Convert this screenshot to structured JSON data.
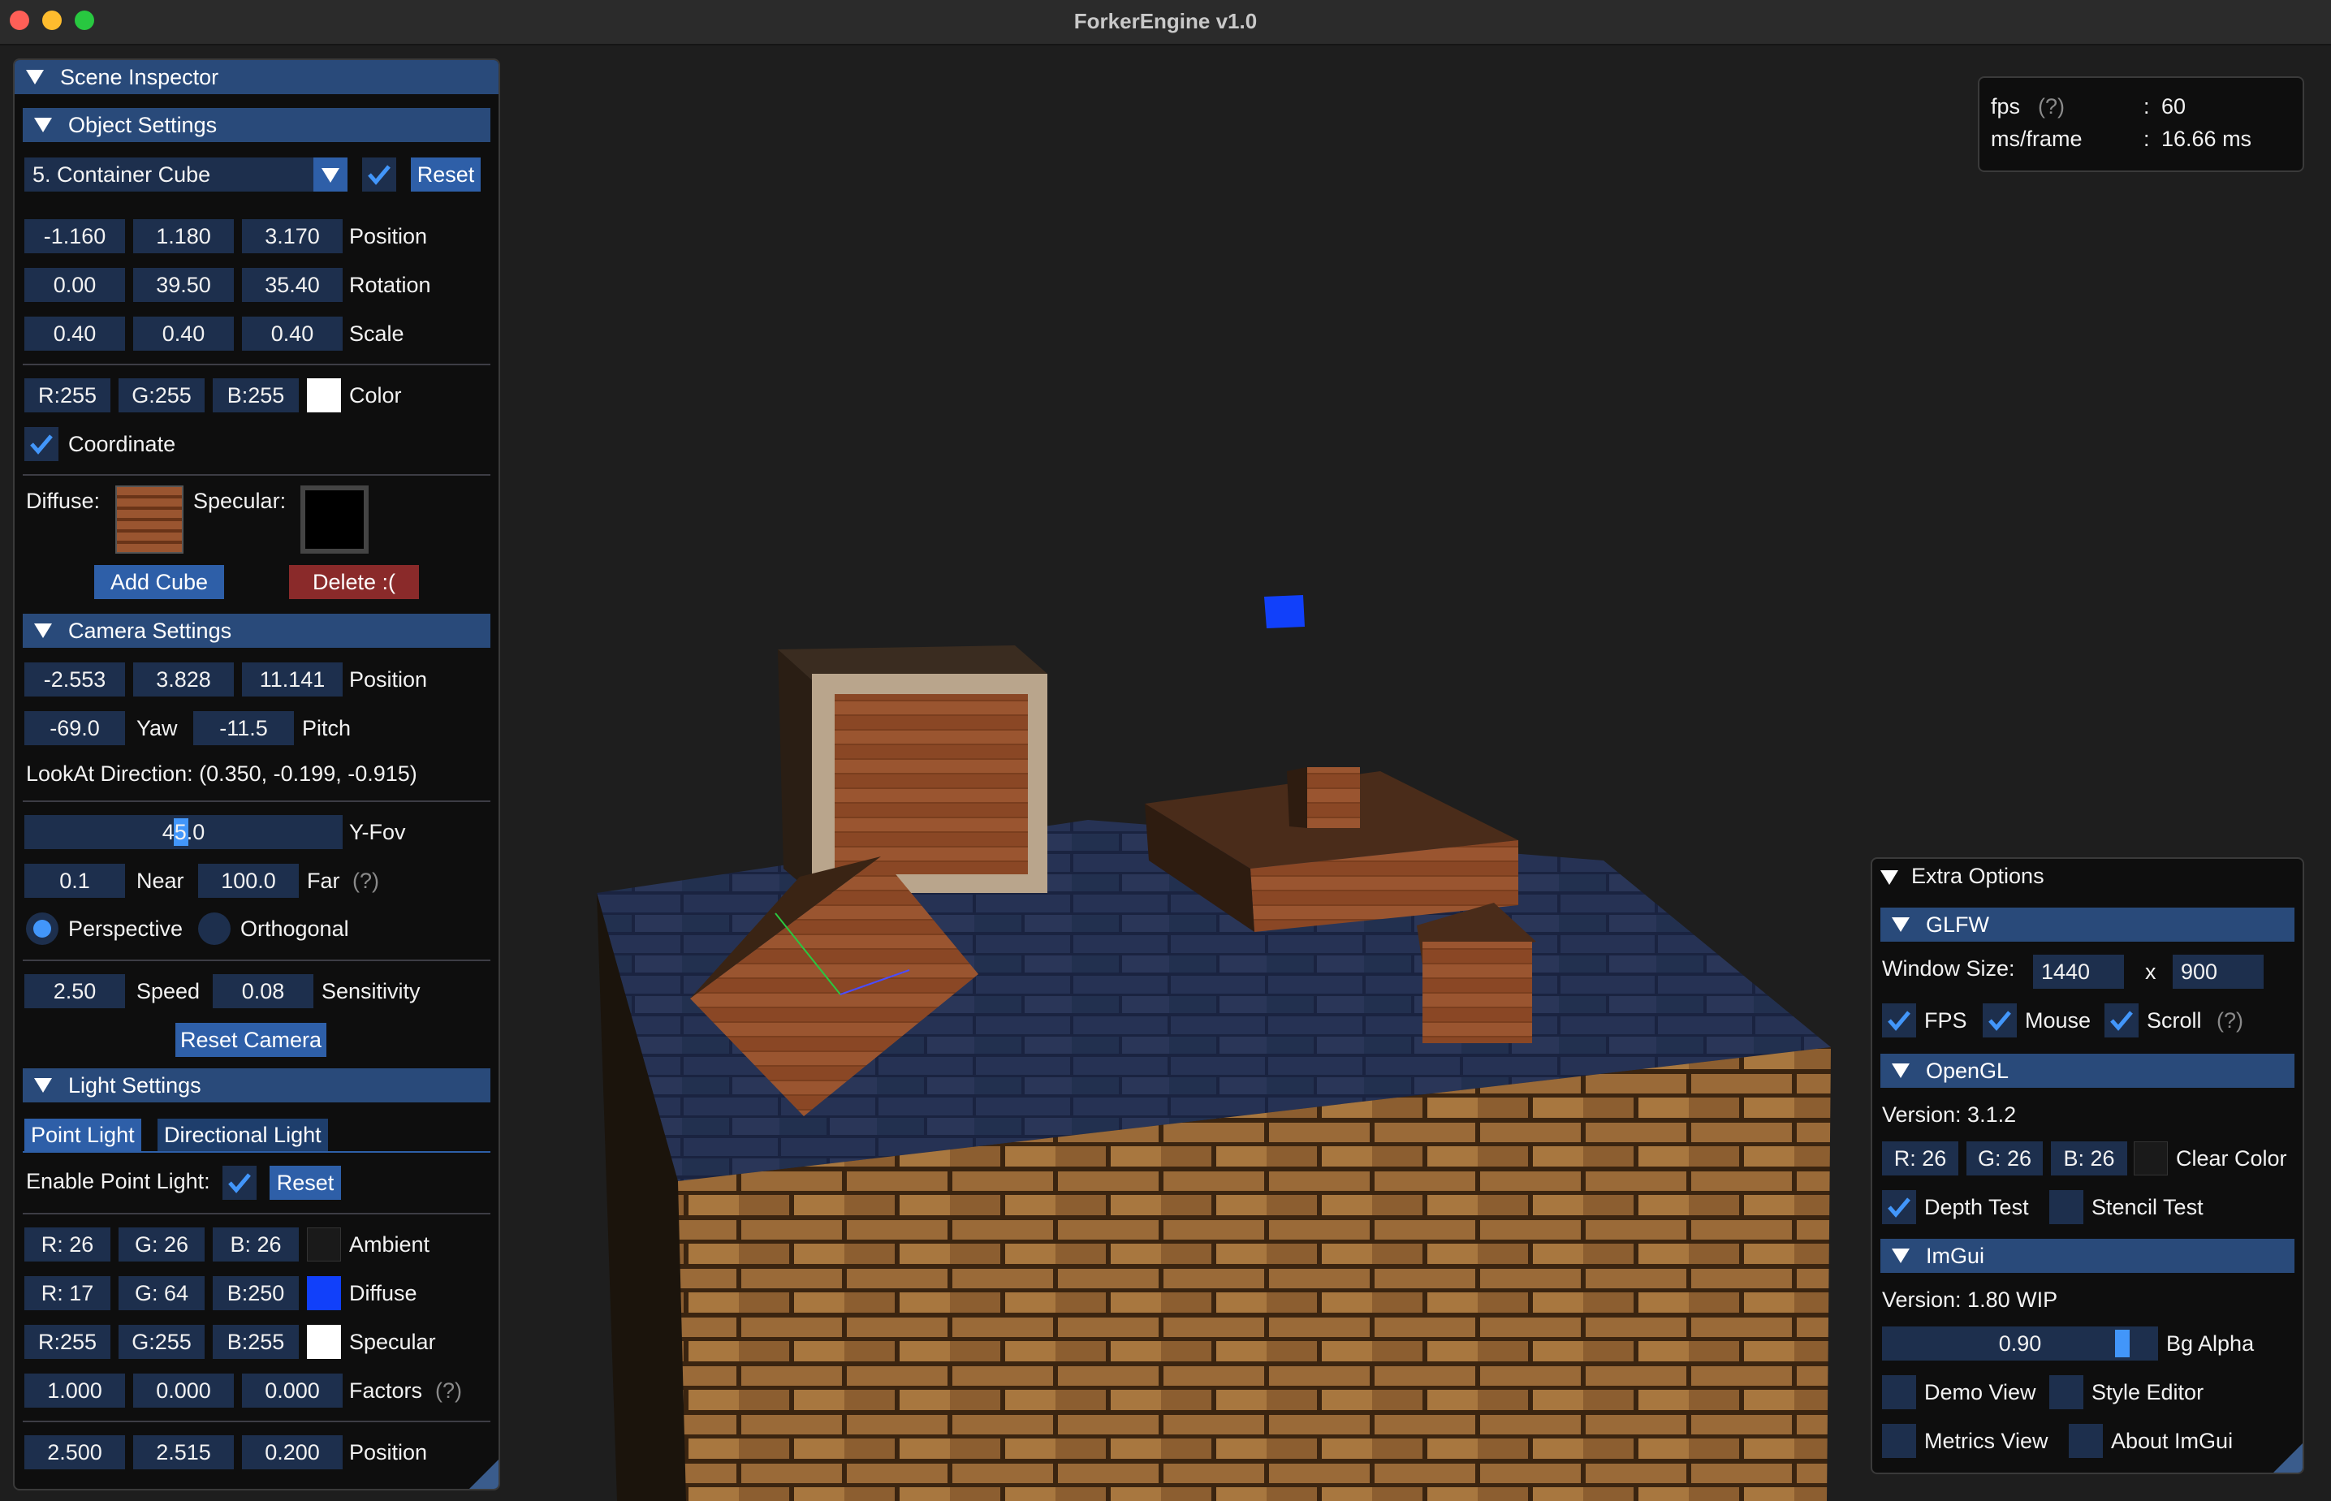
{
  "app": {
    "window_title": "ForkerEngine v1.0"
  },
  "colors": {
    "header": "#294a7a",
    "field": "#1d2f4d",
    "button": "#2e5fa8",
    "delete": "#8a2a2a",
    "check": "#4296fa"
  },
  "scene_inspector": {
    "title": "Scene Inspector",
    "object_settings": {
      "header": "Object Settings",
      "selected_object": "5. Container Cube",
      "reset_label": "Reset",
      "position": [
        "-1.160",
        "1.180",
        "3.170"
      ],
      "position_label": "Position",
      "rotation": [
        "0.00",
        "39.50",
        "35.40"
      ],
      "rotation_label": "Rotation",
      "scale": [
        "0.40",
        "0.40",
        "0.40"
      ],
      "scale_label": "Scale",
      "color": [
        "R:255",
        "G:255",
        "B:255"
      ],
      "color_label": "Color",
      "color_swatch": "#ffffff",
      "coordinate_label": "Coordinate",
      "diffuse_label": "Diffuse:",
      "specular_label": "Specular:",
      "add_cube_label": "Add Cube",
      "delete_label": "Delete :("
    },
    "camera_settings": {
      "header": "Camera Settings",
      "position": [
        "-2.553",
        "3.828",
        "11.141"
      ],
      "position_label": "Position",
      "yaw": "-69.0",
      "yaw_label": "Yaw",
      "pitch": "-11.5",
      "pitch_label": "Pitch",
      "lookat": "LookAt Direction: (0.350, -0.199, -0.915)",
      "fov": "45.0",
      "fov_label": "Y-Fov",
      "near": "0.1",
      "near_label": "Near",
      "far": "100.0",
      "far_label": "Far",
      "help": "(?)",
      "perspective_label": "Perspective",
      "orthogonal_label": "Orthogonal",
      "speed": "2.50",
      "speed_label": "Speed",
      "sensitivity": "0.08",
      "sensitivity_label": "Sensitivity",
      "reset_camera_label": "Reset Camera"
    },
    "light_settings": {
      "header": "Light Settings",
      "tabs": [
        "Point Light",
        "Directional Light"
      ],
      "enable_label": "Enable Point Light:",
      "reset_label": "Reset",
      "ambient": [
        "R: 26",
        "G: 26",
        "B: 26"
      ],
      "ambient_label": "Ambient",
      "ambient_swatch": "#1a1a1a",
      "diffuse": [
        "R: 17",
        "G: 64",
        "B:250"
      ],
      "diffuse_label": "Diffuse",
      "diffuse_swatch": "#1140fa",
      "specular": [
        "R:255",
        "G:255",
        "B:255"
      ],
      "specular_label": "Specular",
      "specular_swatch": "#ffffff",
      "factors": [
        "1.000",
        "0.000",
        "0.000"
      ],
      "factors_label": "Factors",
      "help": "(?)",
      "position": [
        "2.500",
        "2.515",
        "0.200"
      ],
      "position_label": "Position"
    }
  },
  "fps_overlay": {
    "fps_label": "fps",
    "help": "(?)",
    "colon": ":",
    "fps_value": "60",
    "ms_label": "ms/frame",
    "ms_value": "16.66 ms"
  },
  "extra_options": {
    "title": "Extra Options",
    "glfw": {
      "header": "GLFW",
      "window_size_label": "Window Size:",
      "width": "1440",
      "x_label": "x",
      "height": "900",
      "fps_label": "FPS",
      "mouse_label": "Mouse",
      "scroll_label": "Scroll",
      "help": "(?)"
    },
    "opengl": {
      "header": "OpenGL",
      "version": "Version: 3.1.2",
      "clear_color": [
        "R: 26",
        "G: 26",
        "B: 26"
      ],
      "clear_color_label": "Clear Color",
      "clear_swatch": "#1a1a1a",
      "depth_test_label": "Depth Test",
      "stencil_test_label": "Stencil Test"
    },
    "imgui": {
      "header": "ImGui",
      "version": "Version: 1.80 WIP",
      "bg_alpha": "0.90",
      "bg_alpha_fraction": 0.9,
      "bg_alpha_label": "Bg Alpha",
      "demo_view_label": "Demo View",
      "style_editor_label": "Style Editor",
      "metrics_view_label": "Metrics View",
      "about_label": "About ImGui"
    }
  }
}
